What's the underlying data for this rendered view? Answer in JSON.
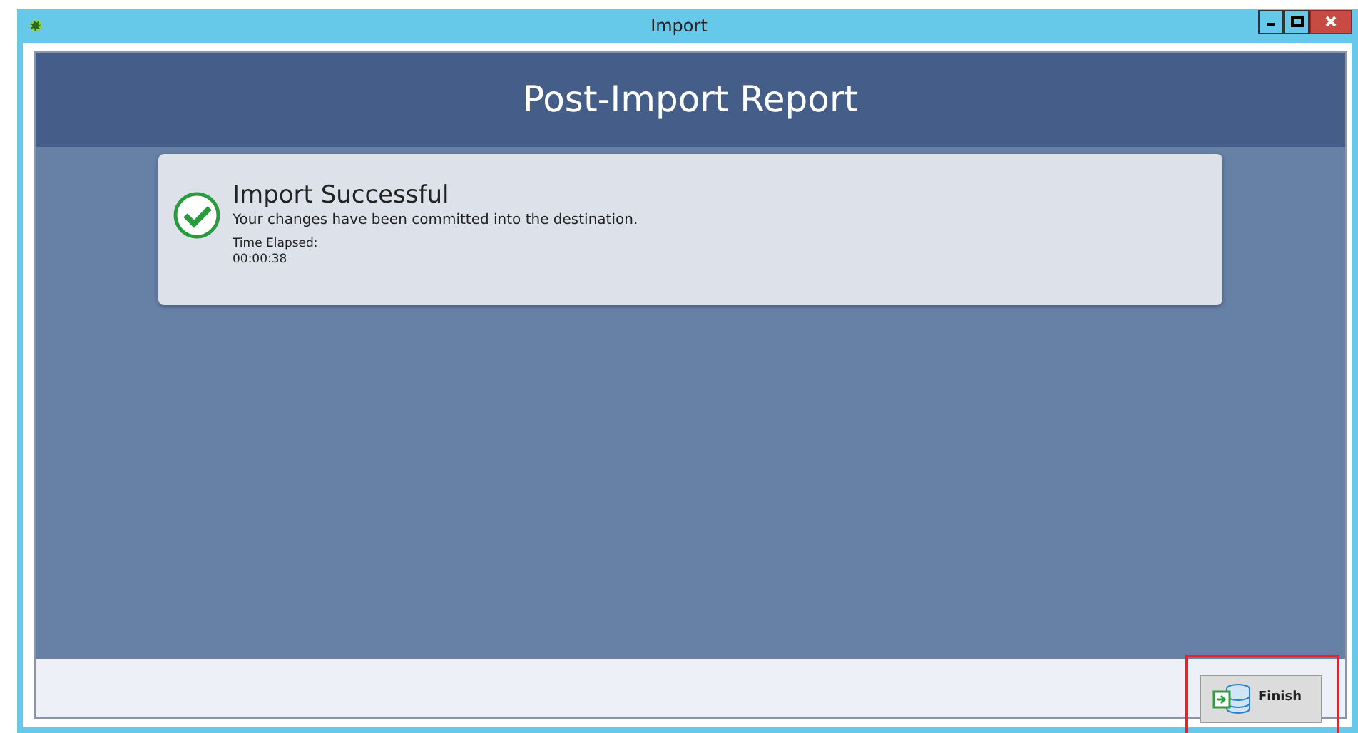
{
  "window": {
    "title": "Import"
  },
  "header": {
    "title": "Post-Import Report"
  },
  "result": {
    "succeeded": true,
    "title": "Import Successful",
    "message": "Your changes have been committed into the destination.",
    "elapsed_label": "Time Elapsed:",
    "elapsed_value": "00:00:38"
  },
  "footer": {
    "buttons": [
      {
        "label": "Finish",
        "highlighted": true
      }
    ]
  }
}
